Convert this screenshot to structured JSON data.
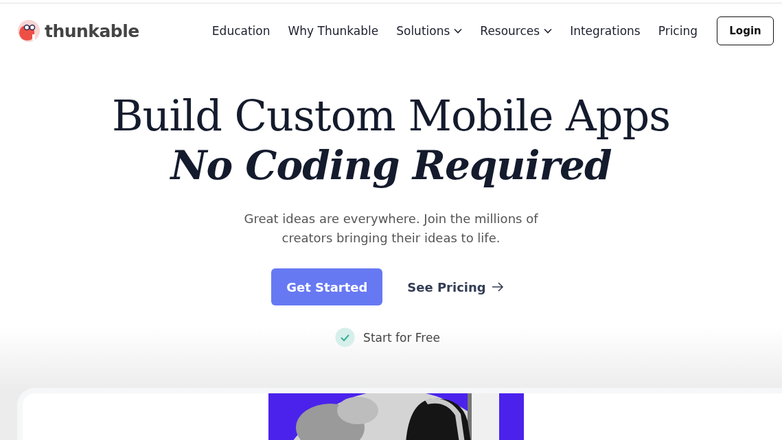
{
  "logo": {
    "text": "thunkable"
  },
  "nav": [
    {
      "label": "Education",
      "dropdown": false
    },
    {
      "label": "Why Thunkable",
      "dropdown": false
    },
    {
      "label": "Solutions",
      "dropdown": true
    },
    {
      "label": "Resources",
      "dropdown": true
    },
    {
      "label": "Integrations",
      "dropdown": false
    },
    {
      "label": "Pricing",
      "dropdown": false
    }
  ],
  "login": {
    "label": "Login"
  },
  "hero": {
    "title_line1": "Build Custom Mobile Apps",
    "title_line2": "No Coding Required",
    "subtitle": "Great ideas are everywhere. Join the millions of creators bringing their ideas to life.",
    "primary_button": "Get Started",
    "secondary_link": "See Pricing",
    "note": "Start for Free"
  }
}
